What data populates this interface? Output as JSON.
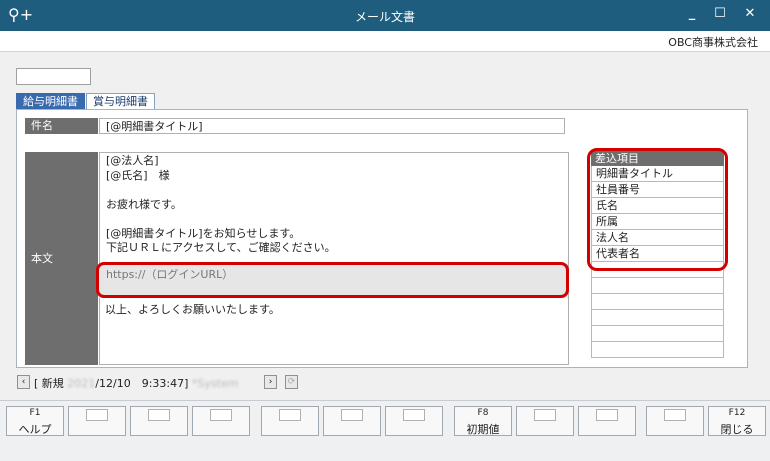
{
  "window": {
    "title": "メール文書",
    "minimize": "_",
    "maximize": "☐",
    "close": "✕"
  },
  "company": "OBC商事株式会社",
  "tabs": [
    {
      "label": "給与明細書"
    },
    {
      "label": "賞与明細書"
    }
  ],
  "form": {
    "subject_label": "件名",
    "subject_value": "[@明細書タイトル]",
    "body_label": "本文",
    "body_lines": [
      "[@法人名]",
      "[@氏名]　様",
      "",
      "お疲れ様です。",
      "",
      "[@明細書タイトル]をお知らせします。",
      "下記ＵＲＬにアクセスして、ご確認ください。"
    ],
    "url_placeholder": "https://（ログインURL）",
    "closing": "以上、よろしくお願いいたします。"
  },
  "fields": {
    "header": "差込項目",
    "items": [
      "明細書タイトル",
      "社員番号",
      "氏名",
      "所属",
      "法人名",
      "代表者名"
    ]
  },
  "status": {
    "mode": "[ 新規",
    "year": "2021",
    "date_rest": "/12/10　9:33:47]",
    "user": "*System"
  },
  "fkeys": [
    {
      "code": "F1",
      "label": "ヘルプ"
    },
    {
      "code": "",
      "label": ""
    },
    {
      "code": "",
      "label": ""
    },
    {
      "code": "",
      "label": ""
    },
    {
      "code": "",
      "label": ""
    },
    {
      "code": "",
      "label": ""
    },
    {
      "code": "",
      "label": ""
    },
    {
      "code": "F8",
      "label": "初期値"
    },
    {
      "code": "",
      "label": ""
    },
    {
      "code": "",
      "label": ""
    },
    {
      "code": "",
      "label": ""
    },
    {
      "code": "F12",
      "label": "閉じる"
    }
  ]
}
